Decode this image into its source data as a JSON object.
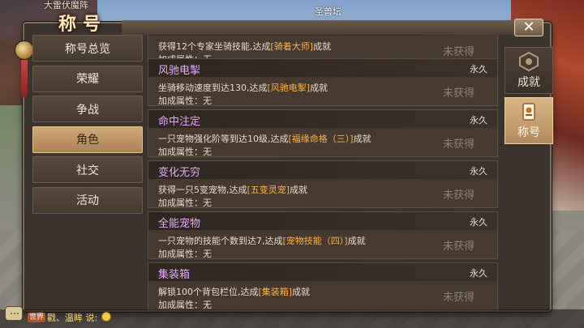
{
  "header": {
    "server_name": "大雷伏魔阵",
    "title": "称号",
    "map_label": "圣兽坛"
  },
  "categories": [
    {
      "label": "称号总览",
      "active": false
    },
    {
      "label": "荣耀",
      "active": false
    },
    {
      "label": "争战",
      "active": false
    },
    {
      "label": "角色",
      "active": true
    },
    {
      "label": "社交",
      "active": false
    },
    {
      "label": "活动",
      "active": false
    }
  ],
  "entries": [
    {
      "name": "",
      "duration": "",
      "desc_pre": "获得12个专家坐骑技能,达成",
      "desc_hl": "[骑着大师]",
      "desc_post": "成就",
      "attr": "加成属性：无",
      "status": "未获得"
    },
    {
      "name": "风驰电掣",
      "duration": "永久",
      "desc_pre": "坐骑移动速度到达130,达成",
      "desc_hl": "[风驰电掣]",
      "desc_post": "成就",
      "attr": "加成属性：无",
      "status": "未获得"
    },
    {
      "name": "命中注定",
      "duration": "永久",
      "desc_pre": "一只宠物强化阶等到达10级,达成",
      "desc_hl": "[福缘命格（三）]",
      "desc_post": "成就",
      "attr": "加成属性：无",
      "status": "未获得"
    },
    {
      "name": "变化无穷",
      "duration": "永久",
      "desc_pre": "获得一只5变宠物,达成",
      "desc_hl": "[五变灵宠]",
      "desc_post": "成就",
      "attr": "加成属性：无",
      "status": "未获得"
    },
    {
      "name": "全能宠物",
      "duration": "永久",
      "desc_pre": "一只宠物的技能个数到达7,达成",
      "desc_hl": "[宠物技能（四）]",
      "desc_post": "成就",
      "attr": "加成属性：无",
      "status": "未获得"
    },
    {
      "name": "集装箱",
      "duration": "永久",
      "desc_pre": "解锁100个背包栏位,达成",
      "desc_hl": "[集装箱]",
      "desc_post": "成就",
      "attr": "加成属性：无",
      "status": "未获得"
    }
  ],
  "tabs": [
    {
      "label": "成就",
      "icon": "achievement-emblem-icon",
      "active": false
    },
    {
      "label": "称号",
      "icon": "title-scroll-icon",
      "active": true
    }
  ],
  "chat": {
    "channel": "世界",
    "text": "戳、温眸 说:"
  },
  "colors": {
    "entry_name": "#e9a8ff",
    "highlight": "#ffb14a",
    "active_category": "#cfa876"
  }
}
